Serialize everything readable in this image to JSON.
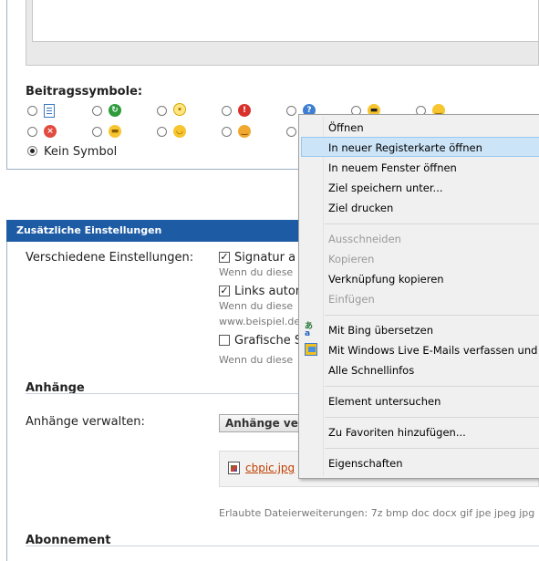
{
  "post_icons": {
    "heading": "Beitragssymbole:",
    "no_icon_label": "Kein Symbol",
    "icons": [
      "document-icon",
      "recycle-arrow-icon",
      "lightbulb-icon",
      "exclamation-icon",
      "question-icon",
      "sunglasses-smiley-icon",
      "smile-smiley-icon",
      "angry-smiley-icon",
      "grin-smiley-icon",
      "wink-smiley-icon",
      "happy-smiley-icon"
    ],
    "selected": "Kein Symbol"
  },
  "additional_settings": {
    "title": "Zusätzliche Einstellungen",
    "misc_label": "Verschiedene Einstellungen:",
    "options": [
      {
        "label": "Signatur a",
        "checked": true,
        "hint": "Wenn du diese"
      },
      {
        "label": "Links autor",
        "checked": true,
        "hint": "Wenn du diese",
        "hint2": "www.beispiel.de"
      },
      {
        "label": "Grafische S",
        "checked": false,
        "hint": "Wenn du diese"
      }
    ]
  },
  "attachments": {
    "heading": "Anhänge",
    "manage_label": "Anhänge verwalten:",
    "manage_button": "Anhänge verw",
    "file_name": "cbpic.jpg",
    "allowed_ext": "Erlaubte Dateierweiterungen: 7z bmp doc docx gif jpe jpeg jpg"
  },
  "subscription": {
    "heading": "Abonnement"
  },
  "context_menu": {
    "items": [
      {
        "label": "Öffnen",
        "disabled": false
      },
      {
        "label": "In neuer Registerkarte öffnen",
        "disabled": false,
        "highlighted": true
      },
      {
        "label": "In neuem Fenster öffnen",
        "disabled": false
      },
      {
        "label": "Ziel speichern unter...",
        "disabled": false
      },
      {
        "label": "Ziel drucken",
        "disabled": false
      },
      {
        "label": "Ausschneiden",
        "disabled": true
      },
      {
        "label": "Kopieren",
        "disabled": true
      },
      {
        "label": "Verknüpfung kopieren",
        "disabled": false
      },
      {
        "label": "Einfügen",
        "disabled": true
      },
      {
        "label": "Mit Bing übersetzen",
        "disabled": false,
        "icon": "translate-icon"
      },
      {
        "label": "Mit Windows Live E-Mails verfassen und ver",
        "disabled": false,
        "icon": "windows-live-icon"
      },
      {
        "label": "Alle Schnellinfos",
        "disabled": false
      },
      {
        "label": "Element untersuchen",
        "disabled": false
      },
      {
        "label": "Zu Favoriten hinzufügen...",
        "disabled": false
      },
      {
        "label": "Eigenschaften",
        "disabled": false
      }
    ]
  }
}
